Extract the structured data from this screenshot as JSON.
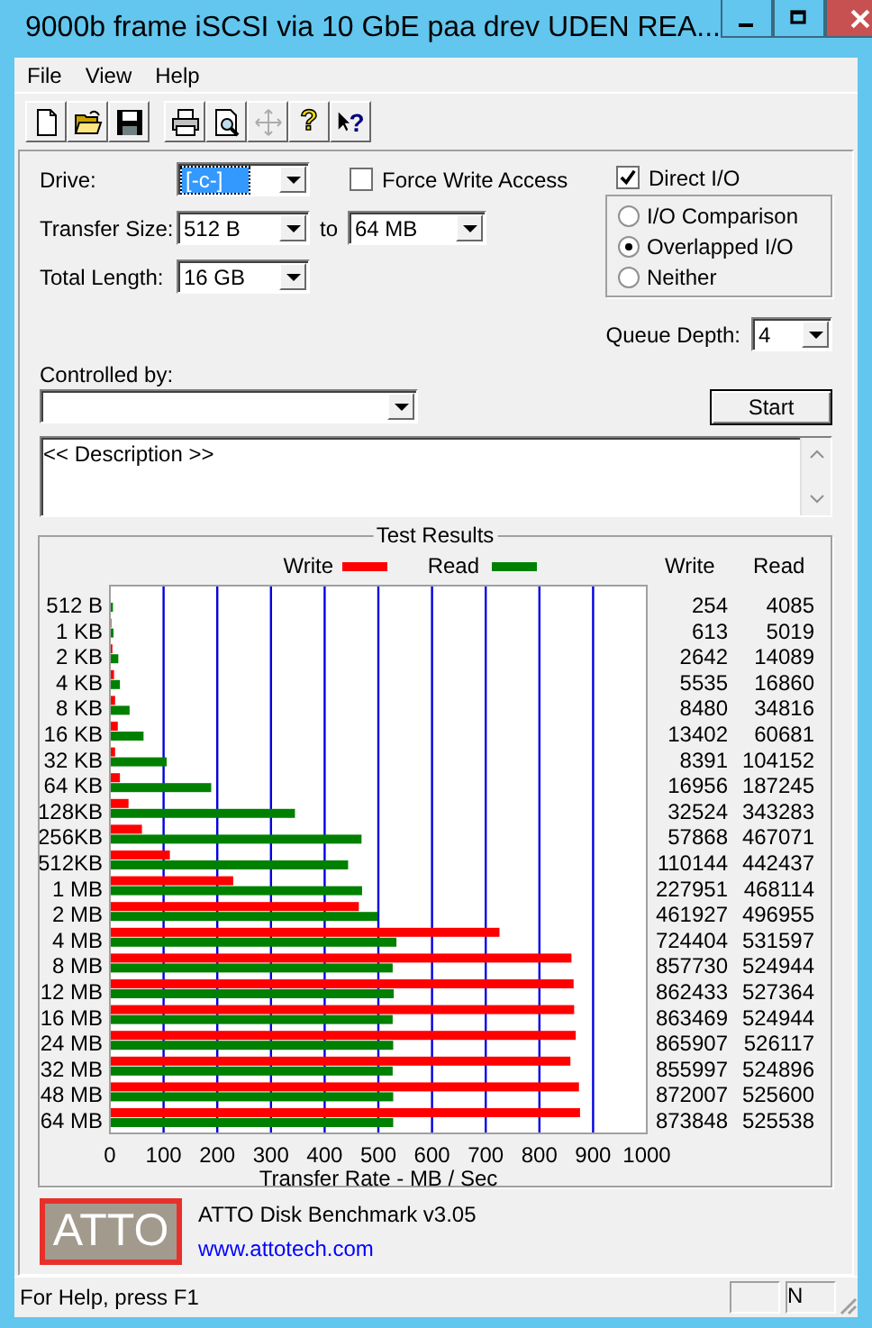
{
  "window": {
    "title": "9000b frame iSCSI via 10 GbE paa drev UDEN REA..."
  },
  "menu": [
    {
      "label": "File"
    },
    {
      "label": "View"
    },
    {
      "label": "Help"
    }
  ],
  "toolbar": [
    [
      {
        "kind": "new",
        "disabled": false
      },
      {
        "kind": "open",
        "disabled": false
      },
      {
        "kind": "save",
        "disabled": false
      }
    ],
    [
      {
        "kind": "print",
        "disabled": false
      },
      {
        "kind": "preview",
        "disabled": false
      },
      {
        "kind": "move",
        "disabled": true
      },
      {
        "kind": "help",
        "glyph": "?",
        "disabled": false
      },
      {
        "kind": "context_help",
        "glyph": "?",
        "disabled": false
      }
    ]
  ],
  "form": {
    "drive": {
      "label": "Drive:",
      "value": "[-c-]",
      "highlighted": true
    },
    "force_write_access": {
      "label": "Force Write Access",
      "checked": false
    },
    "direct_io": {
      "label": "Direct I/O",
      "checked": true
    },
    "io_mode": [
      {
        "label": "I/O Comparison",
        "selected": false
      },
      {
        "label": "Overlapped I/O",
        "selected": true
      },
      {
        "label": "Neither",
        "selected": false
      }
    ],
    "transfer_size": {
      "label": "Transfer Size:",
      "from": "512 B",
      "to_label": "to",
      "to": "64 MB"
    },
    "total_length": {
      "label": "Total Length:",
      "value": "16 GB"
    },
    "queue_depth": {
      "label": "Queue Depth:",
      "value": "4"
    },
    "controlled_by": {
      "label": "Controlled by:"
    },
    "start_button": "Start",
    "description": {
      "value": "<< Description >>"
    }
  },
  "test_results": {
    "title": "Test Results",
    "columns": [
      "Write",
      "Read"
    ],
    "rows": [
      [
        "254",
        "4085"
      ],
      [
        "613",
        "5019"
      ],
      [
        "2642",
        "14089"
      ],
      [
        "5535",
        "16860"
      ],
      [
        "8480",
        "34816"
      ],
      [
        "13402",
        "60681"
      ],
      [
        "8391",
        "104152"
      ],
      [
        "16956",
        "187245"
      ],
      [
        "32524",
        "343283"
      ],
      [
        "57868",
        "467071"
      ],
      [
        "110144",
        "442437"
      ],
      [
        "227951",
        "468114"
      ],
      [
        "461927",
        "496955"
      ],
      [
        "724404",
        "531597"
      ],
      [
        "857730",
        "524944"
      ],
      [
        "862433",
        "527364"
      ],
      [
        "863469",
        "524944"
      ],
      [
        "865907",
        "526117"
      ],
      [
        "855997",
        "524896"
      ],
      [
        "872007",
        "525600"
      ],
      [
        "873848",
        "525538"
      ]
    ],
    "chart_data": {
      "type": "bar",
      "orientation": "horizontal",
      "xlabel": "Transfer Rate - MB / Sec",
      "categories": [
        "512 B",
        "1 KB",
        "2 KB",
        "4 KB",
        "8 KB",
        "16 KB",
        "32 KB",
        "64 KB",
        "128KB",
        "256KB",
        "512KB",
        "1 MB",
        "2 MB",
        "4 MB",
        "8 MB",
        "12 MB",
        "16 MB",
        "24 MB",
        "32 MB",
        "48 MB",
        "64 MB"
      ],
      "series": [
        {
          "name": "Write",
          "color": "#ff0000",
          "values": [
            0,
            1,
            3,
            6,
            8,
            13,
            8,
            17,
            33,
            58,
            110,
            228,
            462,
            724,
            858,
            862,
            863,
            866,
            856,
            872,
            874
          ]
        },
        {
          "name": "Read",
          "color": "#008000",
          "values": [
            4,
            5,
            14,
            17,
            35,
            61,
            104,
            187,
            343,
            467,
            442,
            468,
            497,
            532,
            525,
            527,
            525,
            526,
            525,
            526,
            526
          ]
        }
      ],
      "grid": true,
      "legend": "top",
      "xlim": [
        0,
        1000
      ],
      "xticks": [
        0,
        100,
        200,
        300,
        400,
        500,
        600,
        700,
        800,
        900,
        1000
      ]
    }
  },
  "footer": {
    "logo": "ATTO",
    "product": "ATTO Disk Benchmark v3.05",
    "link": "www.attotech.com"
  },
  "status_bar": {
    "text": "For Help, press F1",
    "panel_2": "N"
  }
}
